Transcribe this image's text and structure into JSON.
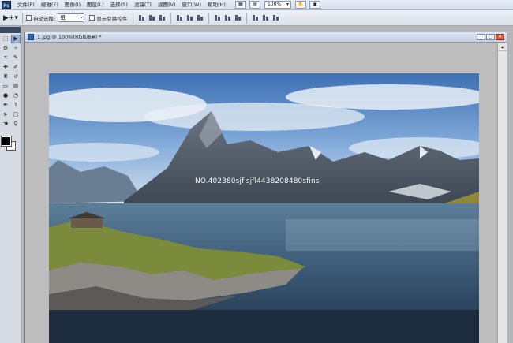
{
  "menubar": {
    "logo": "Ps",
    "items": [
      "文件(F)",
      "编辑(E)",
      "图像(I)",
      "图层(L)",
      "选择(S)",
      "滤镜(T)",
      "视图(V)",
      "窗口(W)",
      "帮助(H)"
    ],
    "zoom": "100%"
  },
  "options": {
    "auto_select_label": "自动选择:",
    "auto_select_value": "组",
    "show_transform_label": "显示变换控件"
  },
  "document": {
    "title": "1.jpg @ 100%(RGB/8#) *",
    "watermark": "NO.402380sjflsjfl4438208480sfins"
  },
  "colors": {
    "foreground": "#000000",
    "background": "#ffffff"
  }
}
